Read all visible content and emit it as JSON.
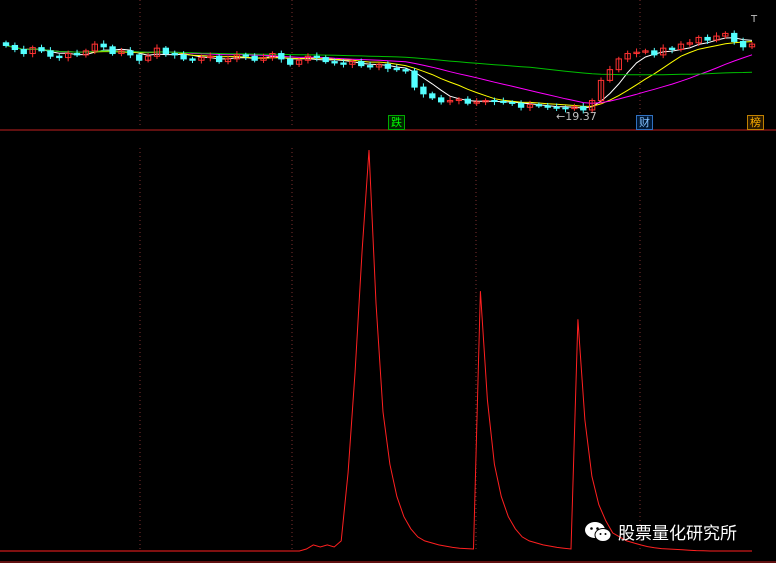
{
  "colors": {
    "background": "#000000",
    "divider": "#c02020",
    "gridline": "#803030",
    "candle_up": "#ff3232",
    "candle_down": "#54ffff",
    "ma_white": "#ffffff",
    "ma_yellow": "#ffff00",
    "ma_magenta": "#ff00ff",
    "ma_green": "#00c000",
    "indicator_line": "#ff2020"
  },
  "price_panel": {
    "low_marker_label": "←19.37",
    "corner_mark": "T",
    "event_tags": [
      {
        "text": "跌",
        "kind": "fall"
      },
      {
        "text": "财",
        "kind": "finance"
      },
      {
        "text": "榜",
        "kind": "ranking"
      }
    ]
  },
  "watermark": {
    "icon": "wechat-icon",
    "text": "股票量化研究所"
  },
  "chart_data": [
    {
      "type": "candlestick",
      "title": "",
      "n_bars": 85,
      "lowest_low": 19.37,
      "closes": [
        21.9,
        21.75,
        21.6,
        21.82,
        21.7,
        21.5,
        21.45,
        21.6,
        21.55,
        21.7,
        21.95,
        21.85,
        21.6,
        21.7,
        21.55,
        21.35,
        21.5,
        21.8,
        21.6,
        21.55,
        21.4,
        21.35,
        21.45,
        21.5,
        21.3,
        21.4,
        21.55,
        21.5,
        21.35,
        21.45,
        21.6,
        21.4,
        21.2,
        21.35,
        21.5,
        21.45,
        21.3,
        21.25,
        21.2,
        21.3,
        21.15,
        21.1,
        21.2,
        21.05,
        21.0,
        20.95,
        20.35,
        20.1,
        19.95,
        19.8,
        19.85,
        19.9,
        19.75,
        19.8,
        19.85,
        19.82,
        19.78,
        19.75,
        19.6,
        19.7,
        19.65,
        19.6,
        19.58,
        19.55,
        19.62,
        19.5,
        19.85,
        20.6,
        21.0,
        21.4,
        21.6,
        21.65,
        21.7,
        21.55,
        21.8,
        21.75,
        21.95,
        22.0,
        22.2,
        22.1,
        22.25,
        22.35,
        22.05,
        21.85,
        21.95
      ],
      "moving_averages": [
        {
          "color": "white",
          "period": 5
        },
        {
          "color": "yellow",
          "period": 10
        },
        {
          "color": "magenta",
          "period": 20
        },
        {
          "color": "green",
          "period": 60
        }
      ]
    },
    {
      "type": "line",
      "title": "",
      "series": [
        {
          "color": "red",
          "values": [
            0.5,
            0.5,
            0.5,
            0.5,
            0.5,
            0.5,
            0.5,
            0.5,
            0.5,
            0.5,
            0.5,
            0.5,
            0.5,
            0.5,
            0.5,
            0.5,
            0.5,
            0.5,
            0.5,
            0.5,
            0.5,
            0.5,
            0.5,
            0.5,
            0.5,
            0.5,
            0.5,
            0.5,
            0.5,
            0.5,
            0.5,
            0.5,
            0.5,
            0.5,
            0.5,
            0.5,
            0.5,
            0.5,
            0.5,
            0.5,
            0.5,
            0.5,
            0.5,
            0.5,
            1,
            2,
            1.5,
            2,
            1.5,
            3,
            20,
            45,
            75,
            100,
            62,
            35,
            22,
            14,
            9,
            6,
            4,
            3,
            2.5,
            2,
            1.7,
            1.4,
            1.2,
            1.1,
            1,
            65,
            38,
            22,
            14,
            9,
            6,
            4,
            3,
            2.5,
            2,
            1.7,
            1.4,
            1.2,
            1,
            58,
            33,
            19,
            12,
            8,
            5,
            4,
            3,
            2.5,
            2,
            1.6,
            1.3,
            1.1,
            1,
            0.9,
            0.8,
            0.7,
            0.6,
            0.55,
            0.5,
            0.5,
            0.5,
            0.5,
            0.5,
            0.5,
            0.5
          ]
        }
      ],
      "ylim": [
        0,
        100
      ]
    }
  ]
}
